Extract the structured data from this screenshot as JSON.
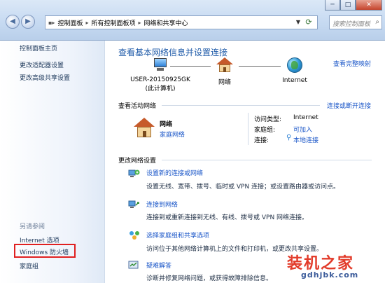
{
  "window": {
    "controls": {
      "minimize": "─",
      "maximize": "□",
      "close": "✕"
    }
  },
  "toolbar": {
    "back": "◀",
    "forward": "▶",
    "breadcrumbs": [
      "控制面板",
      "所有控制面板项",
      "网络和共享中心"
    ],
    "search_placeholder": "搜索控制面板"
  },
  "sidebar": {
    "home": "控制面板主页",
    "links": [
      "更改适配器设置",
      "更改高级共享设置"
    ],
    "see_also_heading": "另请参阅",
    "see_also": [
      "Internet 选项",
      "Windows 防火墙",
      "家庭组"
    ]
  },
  "main": {
    "title": "查看基本网络信息并设置连接",
    "full_map": "查看完整映射",
    "map": {
      "computer": "USER-20150925GK",
      "computer_note": "(此计算机)",
      "network": "网络",
      "internet": "Internet"
    },
    "active_networks": {
      "heading": "查看活动网络",
      "connect_link": "连接或断开连接",
      "name": "网络",
      "type": "家庭网络",
      "access_type_label": "访问类型:",
      "access_type_value": "Internet",
      "homegroup_label": "家庭组:",
      "homegroup_value": "可加入",
      "connections_label": "连接:",
      "connections_value": "本地连接"
    },
    "settings": {
      "heading": "更改网络设置",
      "tasks": [
        {
          "title": "设置新的连接或网络",
          "desc": "设置无线、宽带、拨号、临时或 VPN 连接；或设置路由器或访问点。"
        },
        {
          "title": "连接到网络",
          "desc": "连接到或重新连接到无线、有线、拨号或 VPN 网络连接。"
        },
        {
          "title": "选择家庭组和共享选项",
          "desc": "访问位于其他网络计算机上的文件和打印机，或更改共享设置。"
        },
        {
          "title": "疑难解答",
          "desc": "诊断并修复网络问题，或获得故障排除信息。"
        }
      ]
    }
  },
  "watermark": {
    "title": "装机之家",
    "url": "gdhjbk.com"
  }
}
